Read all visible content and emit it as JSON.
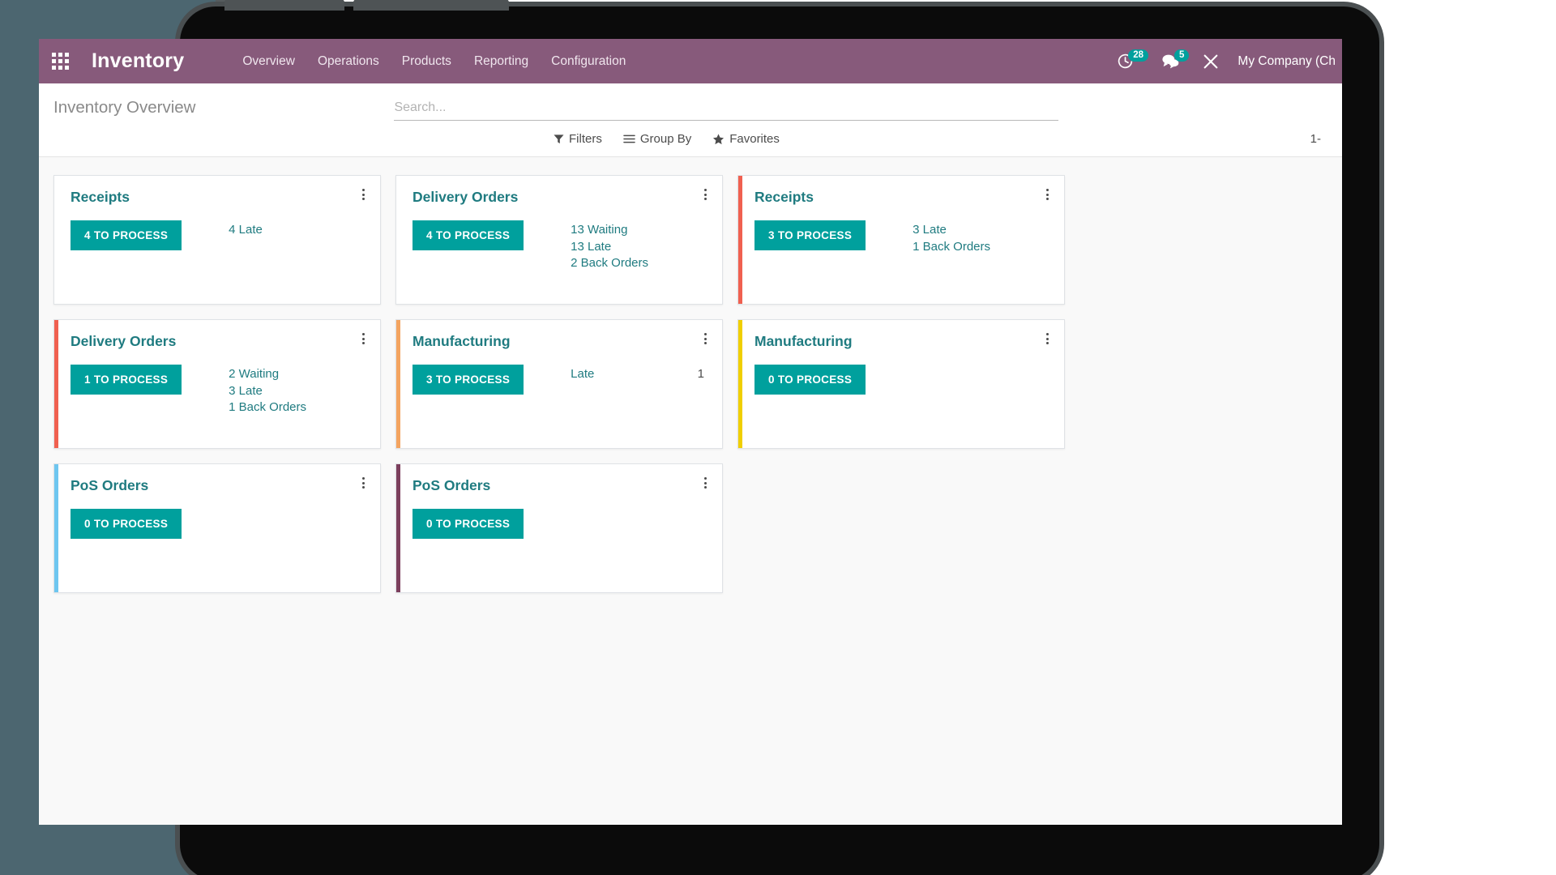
{
  "navbar": {
    "apps_icon": "apps-grid-icon",
    "brand": "Inventory",
    "menu": [
      {
        "label": "Overview"
      },
      {
        "label": "Operations"
      },
      {
        "label": "Products"
      },
      {
        "label": "Reporting"
      },
      {
        "label": "Configuration"
      }
    ],
    "systray": {
      "activities_icon": "clock-activity-icon",
      "activities_count": "28",
      "messages_icon": "chat-bubble-icon",
      "messages_count": "5",
      "debug_icon": "wrench-tools-icon"
    },
    "company": "My Company (Ch",
    "bg_color": "#875A7B"
  },
  "control_panel": {
    "breadcrumb": "Inventory Overview",
    "search_placeholder": "Search...",
    "search_value": "",
    "filters_label": "Filters",
    "filters_icon": "filter-funnel-icon",
    "group_by_label": "Group By",
    "group_by_icon": "hamburger-lines-icon",
    "favorites_label": "Favorites",
    "favorites_icon": "star-icon",
    "pager": "1-"
  },
  "kanban": {
    "button_color": "#00a09d",
    "title_color": "#1f7b80",
    "cards": [
      {
        "title": "Receipts",
        "button": "4 TO PROCESS",
        "stripe": "none",
        "stats": [
          {
            "text": "4 Late"
          }
        ],
        "layout": "text"
      },
      {
        "title": "Delivery Orders",
        "button": "4 TO PROCESS",
        "stripe": "none",
        "stats": [
          {
            "text": "13 Waiting"
          },
          {
            "text": "13 Late"
          },
          {
            "text": "2 Back Orders"
          }
        ],
        "layout": "text"
      },
      {
        "title": "Receipts",
        "button": "3 TO PROCESS",
        "stripe": "#f06050",
        "stats": [
          {
            "text": "3 Late"
          },
          {
            "text": "1 Back Orders"
          }
        ],
        "layout": "text"
      },
      {
        "title": "Delivery Orders",
        "button": "1 TO PROCESS",
        "stripe": "#f06050",
        "stats": [
          {
            "text": "2 Waiting"
          },
          {
            "text": "3 Late"
          },
          {
            "text": "1 Back Orders"
          }
        ],
        "layout": "text"
      },
      {
        "title": "Manufacturing",
        "button": "3 TO PROCESS",
        "stripe": "#f4a460",
        "stats": [
          {
            "text": "Late",
            "value": "1"
          }
        ],
        "layout": "split"
      },
      {
        "title": "Manufacturing",
        "button": "0 TO PROCESS",
        "stripe": "#f0cf00",
        "stats": [],
        "layout": "text"
      },
      {
        "title": "PoS Orders",
        "button": "0 TO PROCESS",
        "stripe": "#6ec6f0",
        "stats": [],
        "layout": "text"
      },
      {
        "title": "PoS Orders",
        "button": "0 TO PROCESS",
        "stripe": "#7c3f5d",
        "stats": [],
        "layout": "text"
      }
    ]
  }
}
